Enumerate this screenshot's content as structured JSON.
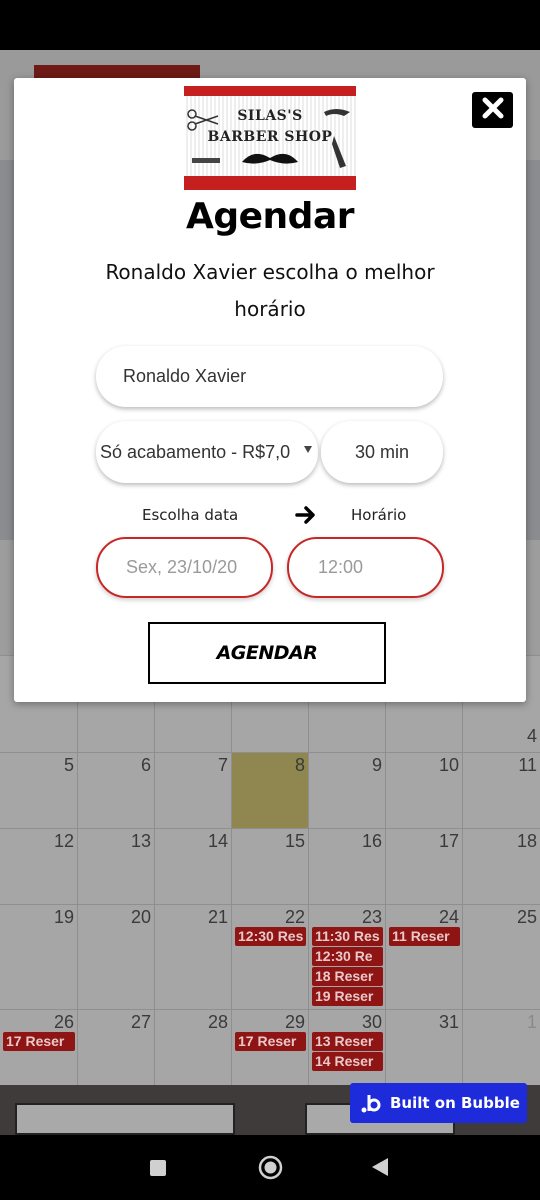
{
  "modal": {
    "logo": {
      "line1": "SILAS'S",
      "line2": "BARBER SHOP"
    },
    "title": "Agendar",
    "subtitle": "Ronaldo Xavier escolha o melhor horário",
    "name_value": "Ronaldo Xavier",
    "service_value": "Só acabamento - R$7,0",
    "duration": "30 min",
    "date_label": "Escolha data",
    "time_label": "Horário",
    "date_placeholder": "Sex, 23/10/20",
    "time_placeholder": "12:00",
    "submit_label": "AGENDAR",
    "accent_color": "#c62828"
  },
  "calendar": {
    "partial_top_right": "4",
    "weeks": [
      {
        "days": [
          "5",
          "6",
          "7",
          "8",
          "9",
          "10",
          "11"
        ]
      },
      {
        "days": [
          "12",
          "13",
          "14",
          "15",
          "16",
          "17",
          "18"
        ]
      },
      {
        "days": [
          "19",
          "20",
          "21",
          "22",
          "23",
          "24",
          "25"
        ]
      },
      {
        "days": [
          "26",
          "27",
          "28",
          "29",
          "30",
          "31",
          "1"
        ]
      }
    ],
    "bookings": {
      "w3_d4": [
        "12:30 Res"
      ],
      "w3_d5": [
        "11:30 Res",
        "12:30 Re",
        "18 Reser",
        "19 Reser"
      ],
      "w3_d6": [
        "11 Reser"
      ],
      "w4_d1": [
        "17 Reser"
      ],
      "w4_d4": [
        "17 Reser"
      ],
      "w4_d5": [
        "13 Reser",
        "14 Reser"
      ]
    }
  },
  "badge": {
    "label": "Built on Bubble"
  },
  "icons": {
    "close": "close-icon",
    "arrow": "arrow-right-icon",
    "nav_recent": "square-icon",
    "nav_home": "circle-icon",
    "nav_back": "back-triangle-icon"
  }
}
